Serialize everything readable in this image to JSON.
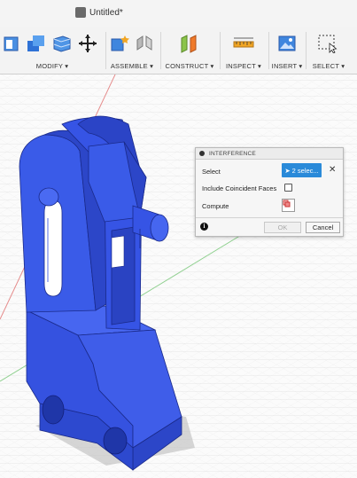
{
  "document": {
    "title": "Untitled*"
  },
  "toolbar": {
    "groups": [
      {
        "label": "MODIFY ▾"
      },
      {
        "label": "ASSEMBLE ▾"
      },
      {
        "label": "CONSTRUCT ▾"
      },
      {
        "label": "INSPECT ▾"
      },
      {
        "label": "INSERT ▾"
      },
      {
        "label": "SELECT ▾"
      }
    ]
  },
  "dialog": {
    "title": "INTERFERENCE",
    "select_label": "Select",
    "select_value": "2 selec...",
    "clear_symbol": "✕",
    "coincident_label": "Include Coincident Faces",
    "coincident_checked": false,
    "compute_label": "Compute",
    "ok_label": "OK",
    "cancel_label": "Cancel",
    "info_symbol": "i"
  },
  "colors": {
    "part": "#3a5be8",
    "part_dark": "#2c46c8",
    "part_edge": "#1a2a8a",
    "accent": "#2a8ad9"
  }
}
